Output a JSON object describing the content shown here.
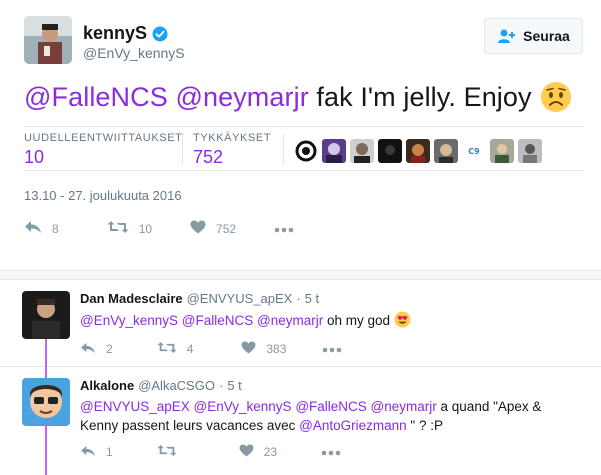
{
  "tweet": {
    "author_name": "kennyS",
    "author_handle": "@EnVy_kennyS",
    "follow_label": "Seuraa",
    "text_mention_1": "@FalleNCS",
    "text_mention_2": "@neymarjr",
    "text_body": "fak I'm jelly. Enjoy",
    "retweets_label": "UUDELLEENTWIITTAUKSET",
    "retweets_value": "10",
    "likes_label": "TYKKÄYKSET",
    "likes_value": "752",
    "timestamp": "13.10 - 27. joulukuuta 2016",
    "reply_count": "8",
    "retweet_count": "10",
    "like_count": "752",
    "liker_avatars": [
      "liker-1",
      "liker-2",
      "liker-3",
      "liker-4",
      "liker-5",
      "liker-6",
      "liker-7",
      "liker-8",
      "liker-9"
    ]
  },
  "replies": [
    {
      "name": "Dan Madesclaire",
      "handle": "@ENVYUS_apEX",
      "dot": "·",
      "time": "5 t",
      "m1": "@EnVy_kennyS",
      "m2": "@FalleNCS",
      "m3": "@neymarjr",
      "text": "oh my god",
      "replies": "2",
      "retweets": "4",
      "likes": "383"
    },
    {
      "name": "Alkalone",
      "handle": "@AlkaCSGO",
      "dot": "·",
      "time": "5 t",
      "m1": "@ENVYUS_apEX",
      "m2": "@EnVy_kennyS",
      "m3": "@FalleNCS",
      "m4": "@neymarjr",
      "text1": "a quand \"Apex &",
      "text2": "Kenny passent leurs vacances avec",
      "m5": "@AntoGriezmann",
      "text3": "\" ? :P",
      "replies": "1",
      "retweets": "",
      "likes": "23"
    }
  ],
  "colors": {
    "accent": "#8a2be2",
    "thread": "#bb66ff",
    "muted": "#657786",
    "icon": "#8899a6"
  }
}
